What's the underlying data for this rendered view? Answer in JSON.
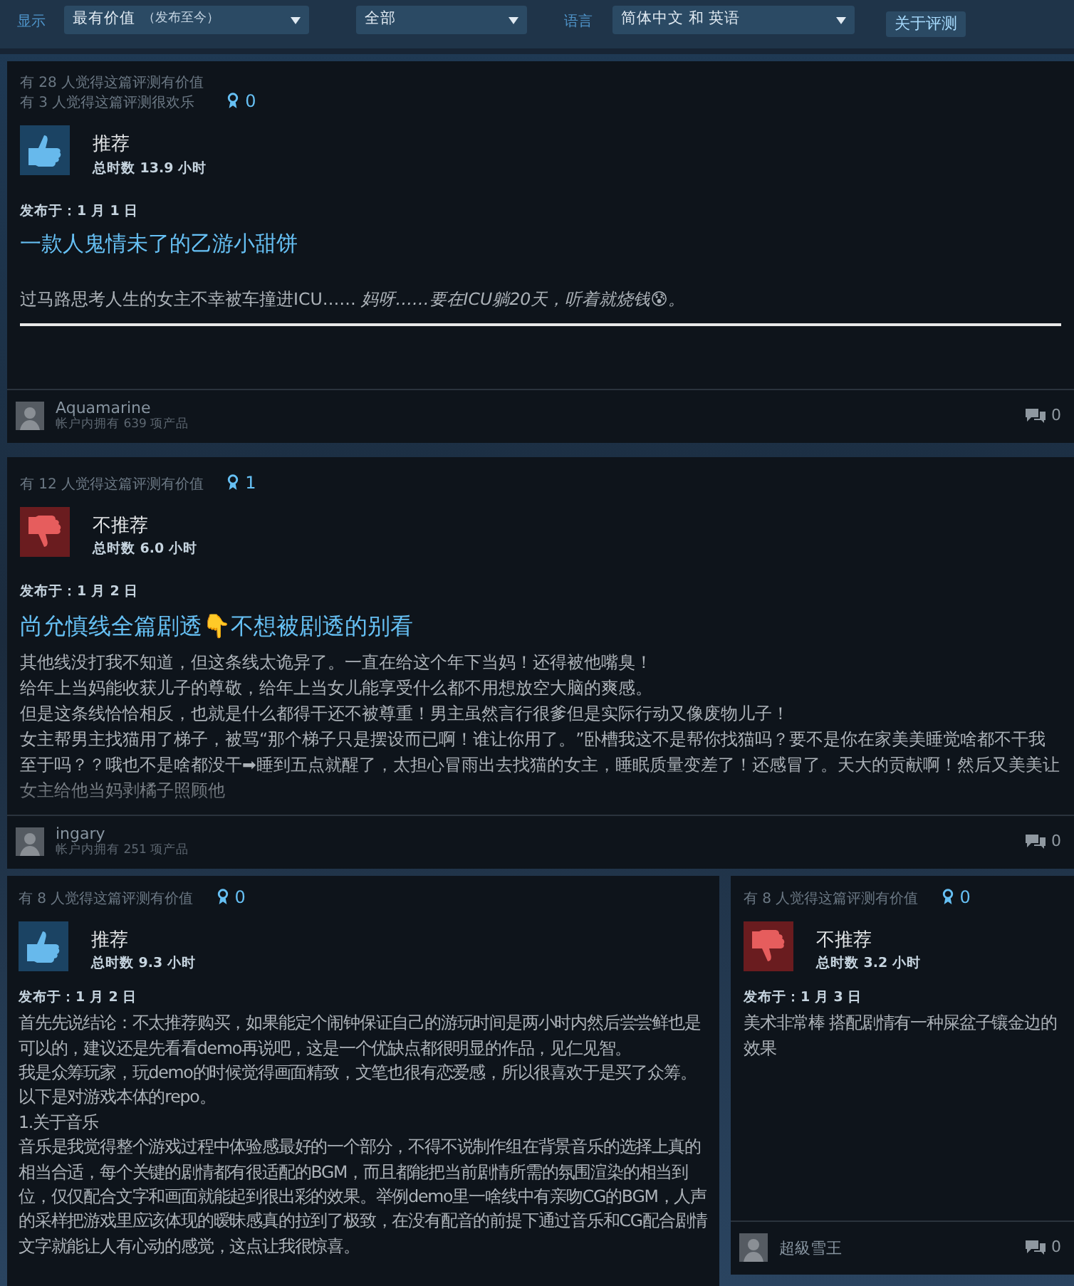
{
  "filter_bar": {
    "items": [
      {
        "kind": "label",
        "text": "显示"
      },
      {
        "kind": "select",
        "value": "最有价值",
        "note": "（发布至今）"
      },
      {
        "kind": "select",
        "value": "全部"
      },
      {
        "kind": "label",
        "text": "语言"
      },
      {
        "kind": "select",
        "value": "简体中文 和 英语"
      },
      {
        "kind": "button",
        "text": "关于评测"
      }
    ]
  },
  "reviews": [
    {
      "helpful": [
        "有 28 人觉得这篇评测有价值",
        "有 3 人觉得这篇评测很欢乐"
      ],
      "awards": "0",
      "recommended": true,
      "verdict": "推荐",
      "playtime": "总时数 13.9 小时",
      "posted": "发布于：1 月 1 日",
      "title": "一款人鬼情未了的乙游小甜饼",
      "body": [
        "过马路思考人生的女主不幸被车撞进ICU…… *妈呀……要在ICU躺20天，听着就烧钱😰。*"
      ],
      "rule": true,
      "faded": false,
      "author": {
        "name": "Aquamarine",
        "products": "帐户内拥有 639 项产品"
      },
      "comments": "0"
    },
    {
      "helpful": [
        "有 12 人觉得这篇评测有价值"
      ],
      "awards": "1",
      "recommended": false,
      "verdict": "不推荐",
      "playtime": "总时数 6.0 小时",
      "posted": "发布于：1 月 2 日",
      "title": "尚允慎线全篇剧透👇不想被剧透的别看",
      "body": [
        "其他线没打我不知道，但这条线太诡异了。一直在给这个年下当妈！还得被他嘴臭！",
        "给年上当妈能收获儿子的尊敬，给年上当女儿能享受什么都不用想放空大脑的爽感。",
        "但是这条线恰恰相反，也就是什么都得干还不被尊重！男主虽然言行很爹但是实际行动又像废物儿子！",
        "女主帮男主找猫用了梯子，被骂“那个梯子只是摆设而已啊！谁让你用了。”卧槽我这不是帮你找猫吗？要不是你在家美美睡觉啥都不干我至于吗？？哦也不是啥都没干➡睡到五点就醒了，太担心冒雨出去找猫的女主，睡眠质量变差了！还感冒了。天大的贡献啊！然后又美美让女主给他当妈剥橘子照顾他"
      ],
      "rule": false,
      "faded": true,
      "author": {
        "name": "ingary",
        "products": "帐户内拥有 251 项产品"
      },
      "comments": "0"
    }
  ],
  "columns": [
    {
      "helpful": [
        "有 8 人觉得这篇评测有价值"
      ],
      "awards": "0",
      "recommended": true,
      "verdict": "推荐",
      "playtime": "总时数 9.3 小时",
      "posted": "发布于：1 月 2 日",
      "body": [
        "首先先说结论：不太推荐购买，如果能定个闹钟保证自己的游玩时间是两小时内然后尝尝鲜也是可以的，建议还是先看看demo再说吧，这是一个优缺点都很明显的作品，见仁见智。",
        "我是众筹玩家，玩demo的时候觉得画面精致，文笔也很有恋爱感，所以很喜欢于是买了众筹。",
        "以下是对游戏本体的repo。",
        "1.关于音乐",
        "音乐是我觉得整个游戏过程中体验感最好的一个部分，不得不说制作组在背景音乐的选择上真的相当合适，每个关键的剧情都有很适配的BGM，而且都能把当前剧情所需的氛围渲染的相当到位，仅仅配合文字和画面就能起到很出彩的效果。举例demo里一啥线中有亲吻CG的BGM，人声的采样把游戏里应该体现的暧昧感真的拉到了极致，在没有配音的前提下通过音乐和CG配合剧情文字就能让人有心动的感觉，这点让我很惊喜。"
      ]
    },
    {
      "helpful": [
        "有 8 人觉得这篇评测有价值"
      ],
      "awards": "0",
      "recommended": false,
      "verdict": "不推荐",
      "playtime": "总时数 3.2 小时",
      "posted": "发布于：1 月 3 日",
      "body": [
        "美术非常棒 搭配剧情有一种屎盆子镶金边的效果"
      ],
      "author": {
        "name": "超級雪王"
      },
      "comments": "0"
    }
  ]
}
